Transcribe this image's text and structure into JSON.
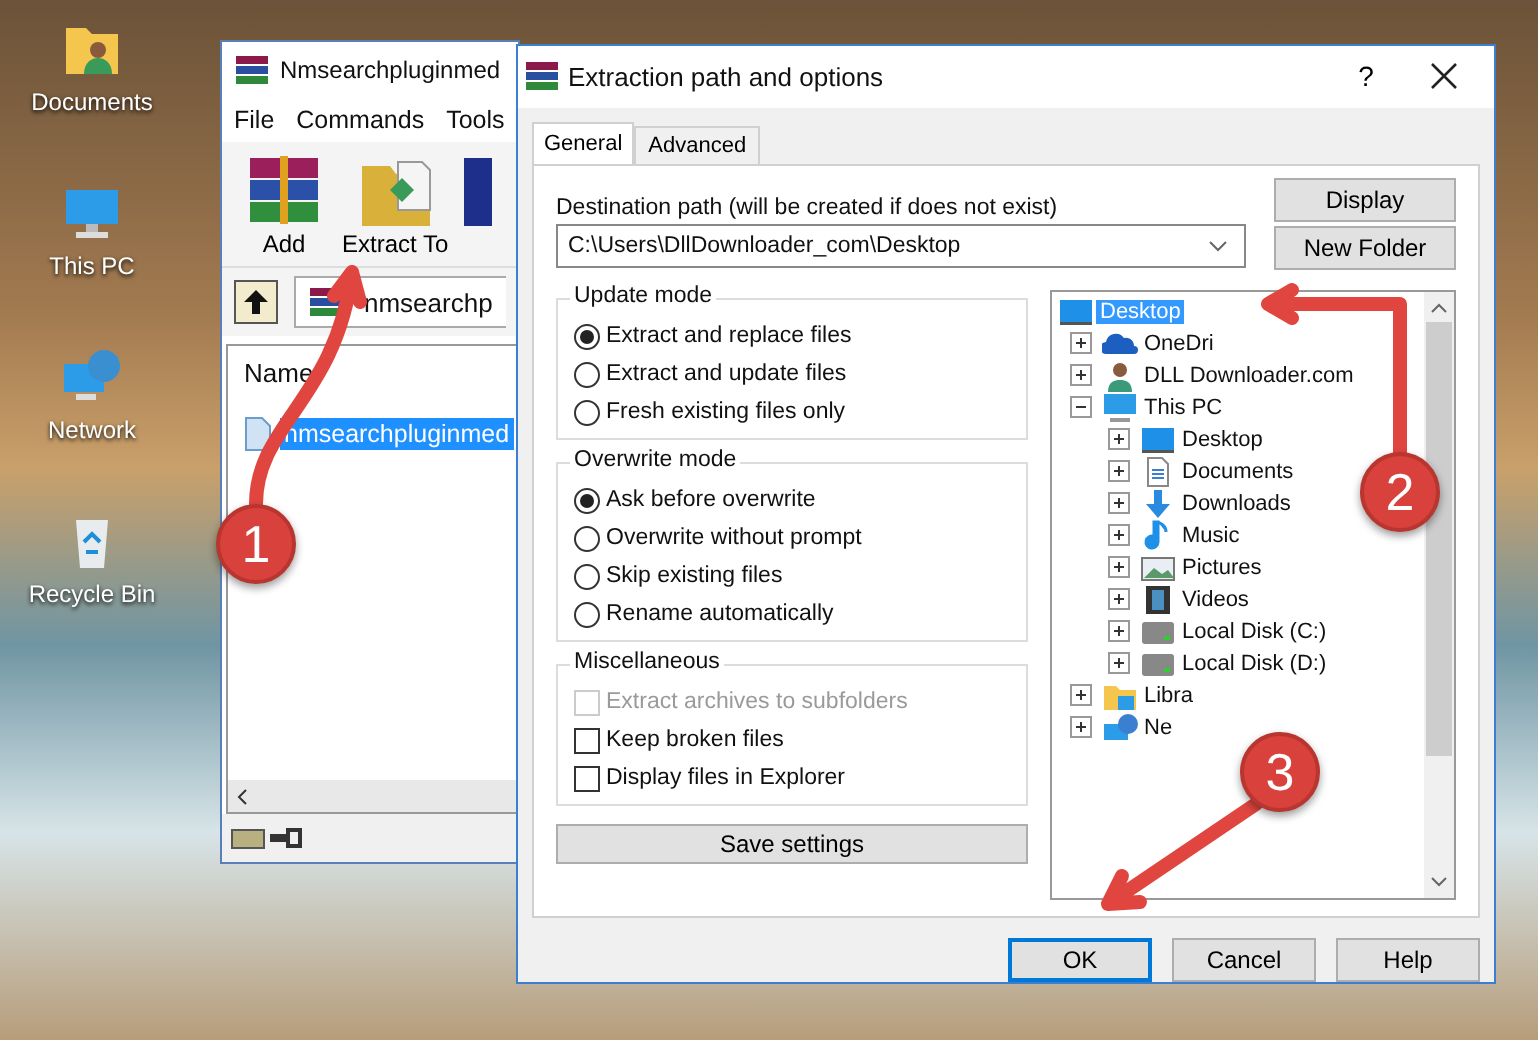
{
  "desktop_icons": [
    {
      "label": "Documents",
      "kind": "documents"
    },
    {
      "label": "This PC",
      "kind": "pc"
    },
    {
      "label": "Network",
      "kind": "network"
    },
    {
      "label": "Recycle Bin",
      "kind": "recycle"
    }
  ],
  "archiver_window": {
    "title": "Nmsearchpluginmed",
    "menu": [
      "File",
      "Commands",
      "Tools"
    ],
    "toolbar": [
      {
        "label": "Add",
        "kind": "add"
      },
      {
        "label": "Extract To",
        "kind": "extract"
      }
    ],
    "address": "nmsearchp",
    "column": "Name",
    "files": [
      {
        "name": "nmsearchpluginmed",
        "selected": true
      }
    ]
  },
  "dialog": {
    "title": "Extraction path and options",
    "help": "?",
    "tabs": [
      {
        "label": "General",
        "selected": true
      },
      {
        "label": "Advanced",
        "selected": false
      }
    ],
    "destination_label": "Destination path (will be created if does not exist)",
    "destination_path": "C:\\Users\\DllDownloader_com\\Desktop",
    "side_buttons": [
      "Display",
      "New Folder"
    ],
    "groups": [
      {
        "title": "Update mode",
        "options": [
          {
            "kind": "radio",
            "label": "Extract and replace files",
            "checked": true
          },
          {
            "kind": "radio",
            "label": "Extract and update files",
            "checked": false
          },
          {
            "kind": "radio",
            "label": "Fresh existing files only",
            "checked": false
          }
        ]
      },
      {
        "title": "Overwrite mode",
        "options": [
          {
            "kind": "radio",
            "label": "Ask before overwrite",
            "checked": true
          },
          {
            "kind": "radio",
            "label": "Overwrite without prompt",
            "checked": false
          },
          {
            "kind": "radio",
            "label": "Skip existing files",
            "checked": false
          },
          {
            "kind": "radio",
            "label": "Rename automatically",
            "checked": false
          }
        ]
      },
      {
        "title": "Miscellaneous",
        "options": [
          {
            "kind": "checkbox",
            "label": "Extract archives to subfolders",
            "checked": false,
            "disabled": true
          },
          {
            "kind": "checkbox",
            "label": "Keep broken files",
            "checked": false,
            "disabled": false
          },
          {
            "kind": "checkbox",
            "label": "Display files in Explorer",
            "checked": false,
            "disabled": false
          }
        ]
      }
    ],
    "save_button": "Save settings",
    "tree": [
      {
        "label": "Desktop",
        "kind": "desktop",
        "selected": true,
        "children": [
          {
            "label": "OneDri",
            "kind": "cloud",
            "selected": false,
            "expanded": false
          },
          {
            "label": "DLL Downloader.com",
            "kind": "user",
            "selected": false,
            "expanded": false
          },
          {
            "label": "This PC",
            "kind": "pc",
            "selected": false,
            "expanded": true,
            "children": [
              {
                "label": "Desktop",
                "kind": "desktop",
                "selected": false,
                "expanded": false
              },
              {
                "label": "Documents",
                "kind": "documents",
                "selected": false,
                "expanded": false
              },
              {
                "label": "Downloads",
                "kind": "downloads",
                "selected": false,
                "expanded": false
              },
              {
                "label": "Music",
                "kind": "music",
                "selected": false,
                "expanded": false
              },
              {
                "label": "Pictures",
                "kind": "pictures",
                "selected": false,
                "expanded": false
              },
              {
                "label": "Videos",
                "kind": "videos",
                "selected": false,
                "expanded": false
              },
              {
                "label": "Local Disk (C:)",
                "kind": "disk",
                "selected": false,
                "expanded": false
              },
              {
                "label": "Local Disk (D:)",
                "kind": "disk",
                "selected": false,
                "expanded": false
              }
            ]
          },
          {
            "label": "Libra",
            "kind": "library",
            "selected": false,
            "expanded": false
          },
          {
            "label": "Ne",
            "kind": "network",
            "selected": false,
            "expanded": false
          }
        ]
      }
    ],
    "buttons": [
      {
        "label": "OK",
        "default": true
      },
      {
        "label": "Cancel",
        "default": false
      },
      {
        "label": "Help",
        "default": false
      }
    ]
  },
  "annotations": [
    {
      "number": "1",
      "kind": "up"
    },
    {
      "number": "2",
      "kind": "up-left"
    },
    {
      "number": "3",
      "kind": "down-left"
    }
  ]
}
